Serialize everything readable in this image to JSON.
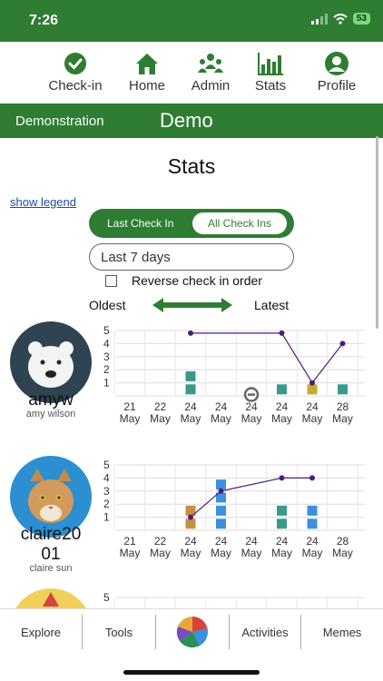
{
  "status": {
    "time": "7:26",
    "battery": "53"
  },
  "nav": {
    "items": [
      {
        "label": "Check-in",
        "icon": "check-circle-icon"
      },
      {
        "label": "Home",
        "icon": "house-icon"
      },
      {
        "label": "Admin",
        "icon": "people-icon"
      },
      {
        "label": "Stats",
        "icon": "bar-chart-icon"
      },
      {
        "label": "Profile",
        "icon": "person-icon"
      }
    ]
  },
  "demo": {
    "subtitle": "Demonstration",
    "title": "Demo"
  },
  "page": {
    "title": "Stats",
    "show_legend": "show legend",
    "toggle_left": "Last Check In",
    "toggle_right": "All Check Ins",
    "range": "Last 7 days",
    "reverse_label": "Reverse check in order",
    "oldest": "Oldest",
    "latest": "Latest"
  },
  "colors": {
    "brand": "#2e7d32",
    "teal": "#3a9a8a",
    "olive": "#c2ad2d",
    "tan": "#c98d45",
    "blue": "#3d8fe0",
    "line": "#4b1e78"
  },
  "users": [
    {
      "username": "amyw",
      "full_name": "amy wilson",
      "avatar": "polar-bear-icon"
    },
    {
      "username": "claire2001",
      "full_name": "claire sun",
      "avatar": "cat-icon"
    }
  ],
  "chart_data": [
    {
      "type": "scatter",
      "categories": [
        "21 May",
        "22 May",
        "24 May",
        "24 May",
        "24 May",
        "24 May",
        "24 May",
        "28 May"
      ],
      "ylim": [
        0,
        5
      ],
      "yticks": [
        1,
        2,
        3,
        4,
        5
      ],
      "grid": true,
      "line": [
        {
          "x": 2,
          "y": 4.8
        },
        {
          "x": 5,
          "y": 4.8
        },
        {
          "x": 6,
          "y": 1
        },
        {
          "x": 7,
          "y": 4
        }
      ],
      "marks": [
        {
          "x": 2,
          "y": 1.5,
          "color": "teal"
        },
        {
          "x": 2,
          "y": 0.5,
          "color": "teal"
        },
        {
          "x": 5,
          "y": 0.5,
          "color": "teal"
        },
        {
          "x": 6,
          "y": 0.5,
          "color": "olive"
        },
        {
          "x": 7,
          "y": 0.5,
          "color": "teal"
        }
      ],
      "no_entry": [
        {
          "x": 4
        }
      ]
    },
    {
      "type": "scatter",
      "categories": [
        "21 May",
        "22 May",
        "24 May",
        "24 May",
        "24 May",
        "24 May",
        "24 May",
        "28 May"
      ],
      "ylim": [
        0,
        5
      ],
      "yticks": [
        1,
        2,
        3,
        4,
        5
      ],
      "grid": true,
      "line": [
        {
          "x": 2,
          "y": 1
        },
        {
          "x": 3,
          "y": 3
        },
        {
          "x": 5,
          "y": 4
        },
        {
          "x": 6,
          "y": 4
        }
      ],
      "marks": [
        {
          "x": 2,
          "y": 1.5,
          "color": "tan"
        },
        {
          "x": 2,
          "y": 0.5,
          "color": "tan"
        },
        {
          "x": 3,
          "y": 3.5,
          "color": "blue"
        },
        {
          "x": 3,
          "y": 2.5,
          "color": "blue"
        },
        {
          "x": 3,
          "y": 1.5,
          "color": "blue"
        },
        {
          "x": 3,
          "y": 0.5,
          "color": "blue"
        },
        {
          "x": 5,
          "y": 1.5,
          "color": "teal"
        },
        {
          "x": 5,
          "y": 0.5,
          "color": "teal"
        },
        {
          "x": 6,
          "y": 1.5,
          "color": "blue"
        },
        {
          "x": 6,
          "y": 0.5,
          "color": "blue"
        }
      ],
      "no_entry": []
    },
    {
      "type": "scatter",
      "ylim": [
        0,
        5
      ],
      "yticks": [
        5
      ],
      "grid": true
    }
  ],
  "bottom_nav": {
    "explore": "Explore",
    "tools": "Tools",
    "center_icon": "pie-chart-icon",
    "activities": "Activities",
    "memes": "Memes"
  }
}
